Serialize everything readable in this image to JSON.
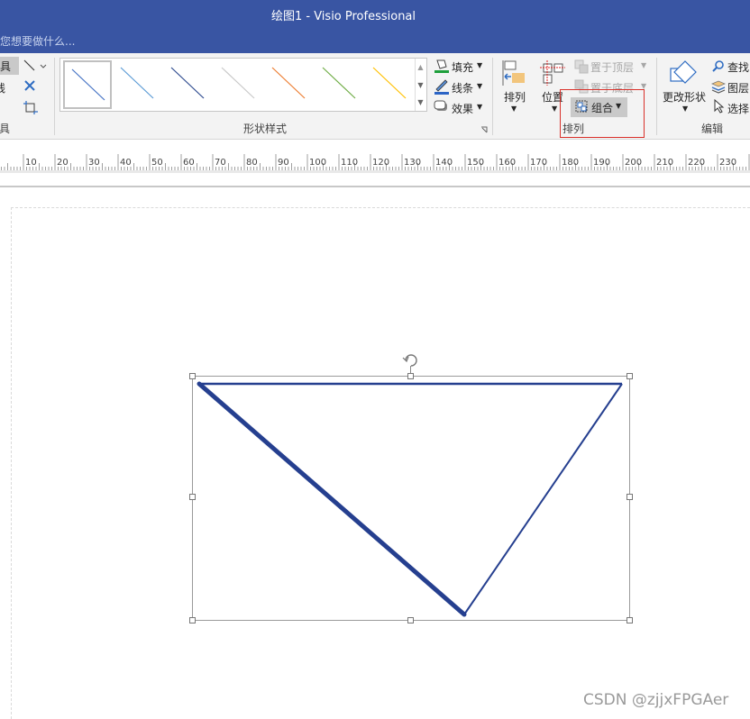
{
  "window": {
    "title": "绘图1 - Visio Professional",
    "tell_me_placeholder": "您想要做什么..."
  },
  "ribbon": {
    "tools_group": {
      "button_label": "工具",
      "item_label": "线",
      "group_label": "具"
    },
    "shape_styles": {
      "group_label": "形状样式",
      "fill_label": "填充",
      "line_label": "线条",
      "effects_label": "效果"
    },
    "arrange": {
      "group_label": "排列",
      "align_label": "排列",
      "position_label": "位置",
      "bring_front_label": "置于顶层",
      "send_back_label": "置于底层",
      "group_label_btn": "组合"
    },
    "editing": {
      "group_label": "编辑",
      "change_shape_label": "更改形状",
      "find_label": "查找",
      "layers_label": "图层",
      "select_label": "选择"
    }
  },
  "ruler": {
    "ticks": [
      "10",
      "20",
      "30",
      "40",
      "50",
      "60",
      "70",
      "80",
      "90",
      "100",
      "110",
      "120",
      "130",
      "140",
      "150",
      "160",
      "170",
      "180",
      "190",
      "200",
      "210",
      "220",
      "230"
    ]
  },
  "gallery": {
    "swatch_colors": [
      "#4472c4",
      "#5b9bd5",
      "#2e4b8f",
      "#c9c9c9",
      "#ed7d31",
      "#70ad47",
      "#ffc000"
    ]
  },
  "drawing": {
    "stroke_color": "#253f8f"
  },
  "watermark": "CSDN @zjjxFPGAer"
}
